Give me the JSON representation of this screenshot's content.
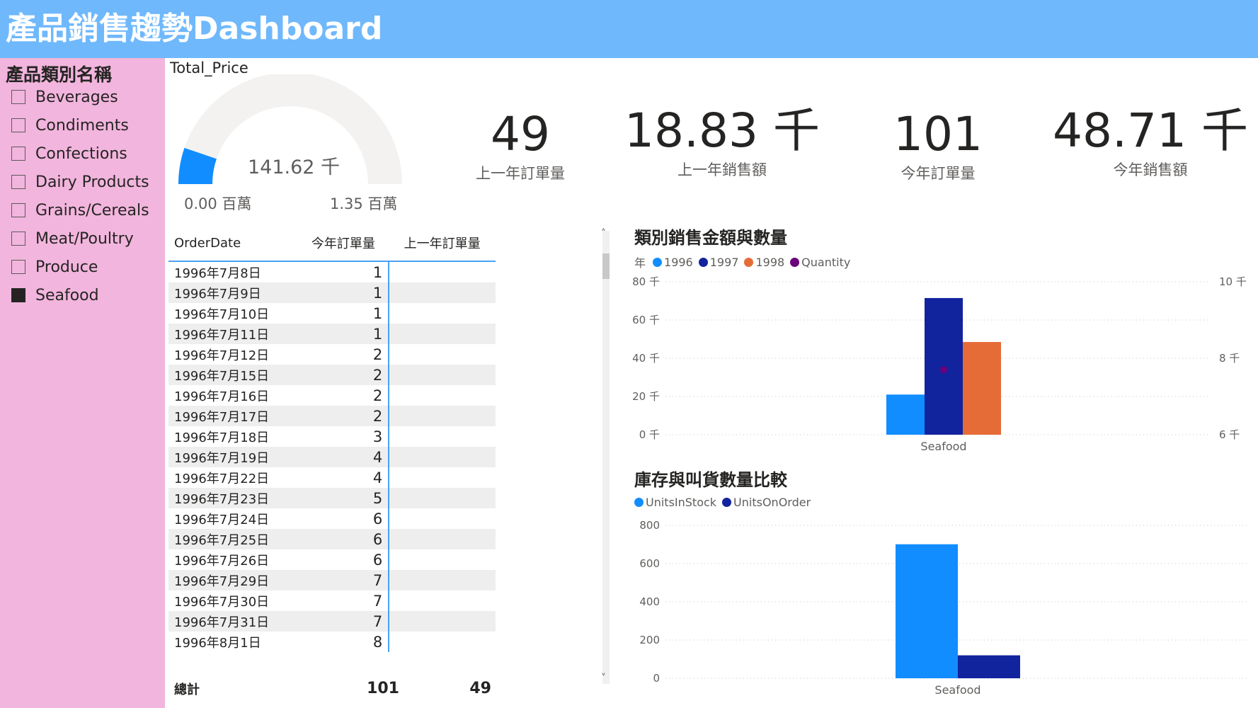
{
  "header": {
    "title": "產品銷售趨勢Dashboard"
  },
  "slicer": {
    "title": "產品類別名稱",
    "items": [
      {
        "label": "Beverages",
        "checked": false
      },
      {
        "label": "Condiments",
        "checked": false
      },
      {
        "label": "Confections",
        "checked": false
      },
      {
        "label": "Dairy Products",
        "checked": false
      },
      {
        "label": "Grains/Cereals",
        "checked": false
      },
      {
        "label": "Meat/Poultry",
        "checked": false
      },
      {
        "label": "Produce",
        "checked": false
      },
      {
        "label": "Seafood",
        "checked": true
      }
    ]
  },
  "gauge": {
    "title": "Total_Price",
    "value_label": "141.62 千",
    "min_label": "0.00 百萬",
    "max_label": "1.35 百萬",
    "value": 141620,
    "min": 0,
    "max": 1350000,
    "fill_color": "#118dff",
    "track_color": "#f3f2f1"
  },
  "kpis": [
    {
      "value": "49",
      "label": "上一年訂單量"
    },
    {
      "value": "18.83 千",
      "label": "上一年銷售額"
    },
    {
      "value": "101",
      "label": "今年訂單量"
    },
    {
      "value": "48.71 千",
      "label": "今年銷售額"
    }
  ],
  "table": {
    "columns": [
      "OrderDate",
      "今年訂單量",
      "上一年訂單量"
    ],
    "rows": [
      {
        "date": "1996年7月8日",
        "this_year": "1",
        "last_year": ""
      },
      {
        "date": "1996年7月9日",
        "this_year": "1",
        "last_year": ""
      },
      {
        "date": "1996年7月10日",
        "this_year": "1",
        "last_year": ""
      },
      {
        "date": "1996年7月11日",
        "this_year": "1",
        "last_year": ""
      },
      {
        "date": "1996年7月12日",
        "this_year": "2",
        "last_year": ""
      },
      {
        "date": "1996年7月15日",
        "this_year": "2",
        "last_year": ""
      },
      {
        "date": "1996年7月16日",
        "this_year": "2",
        "last_year": ""
      },
      {
        "date": "1996年7月17日",
        "this_year": "2",
        "last_year": ""
      },
      {
        "date": "1996年7月18日",
        "this_year": "3",
        "last_year": ""
      },
      {
        "date": "1996年7月19日",
        "this_year": "4",
        "last_year": ""
      },
      {
        "date": "1996年7月22日",
        "this_year": "4",
        "last_year": ""
      },
      {
        "date": "1996年7月23日",
        "this_year": "5",
        "last_year": ""
      },
      {
        "date": "1996年7月24日",
        "this_year": "6",
        "last_year": ""
      },
      {
        "date": "1996年7月25日",
        "this_year": "6",
        "last_year": ""
      },
      {
        "date": "1996年7月26日",
        "this_year": "6",
        "last_year": ""
      },
      {
        "date": "1996年7月29日",
        "this_year": "7",
        "last_year": ""
      },
      {
        "date": "1996年7月30日",
        "this_year": "7",
        "last_year": ""
      },
      {
        "date": "1996年7月31日",
        "this_year": "7",
        "last_year": ""
      },
      {
        "date": "1996年8月1日",
        "this_year": "8",
        "last_year": ""
      }
    ],
    "total_label": "總計",
    "total_this_year": "101",
    "total_last_year": "49"
  },
  "chart_data": [
    {
      "type": "bar",
      "title": "類別銷售金額與數量",
      "legend_title": "年",
      "legend_position": "top-left",
      "categories": [
        "Seafood"
      ],
      "series": [
        {
          "name": "1996",
          "values": [
            21000
          ],
          "color": "#118dff"
        },
        {
          "name": "1997",
          "values": [
            71500
          ],
          "color": "#12239e"
        },
        {
          "name": "1998",
          "values": [
            48500
          ],
          "color": "#e66c37"
        }
      ],
      "line_series": {
        "name": "Quantity",
        "values": [
          7700
        ],
        "color": "#6b007b"
      },
      "ylim": [
        0,
        80000
      ],
      "y_ticks": [
        "0 千",
        "20 千",
        "40 千",
        "60 千",
        "80 千"
      ],
      "y_tick_values": [
        0,
        20000,
        40000,
        60000,
        80000
      ],
      "y2lim": [
        6000,
        10000
      ],
      "y2_ticks": [
        "6 千",
        "8 千",
        "10 千"
      ],
      "y2_tick_values": [
        6000,
        8000,
        10000
      ],
      "grid": true
    },
    {
      "type": "bar",
      "title": "庫存與叫貨數量比較",
      "legend_position": "top-left",
      "categories": [
        "Seafood"
      ],
      "series": [
        {
          "name": "UnitsInStock",
          "values": [
            701
          ],
          "color": "#118dff"
        },
        {
          "name": "UnitsOnOrder",
          "values": [
            120
          ],
          "color": "#12239e"
        }
      ],
      "ylim": [
        0,
        800
      ],
      "y_ticks": [
        "0",
        "200",
        "400",
        "600",
        "800"
      ],
      "y_tick_values": [
        0,
        200,
        400,
        600,
        800
      ],
      "grid": true
    }
  ],
  "scrollbar": {
    "up": "˄",
    "down": "˅"
  }
}
